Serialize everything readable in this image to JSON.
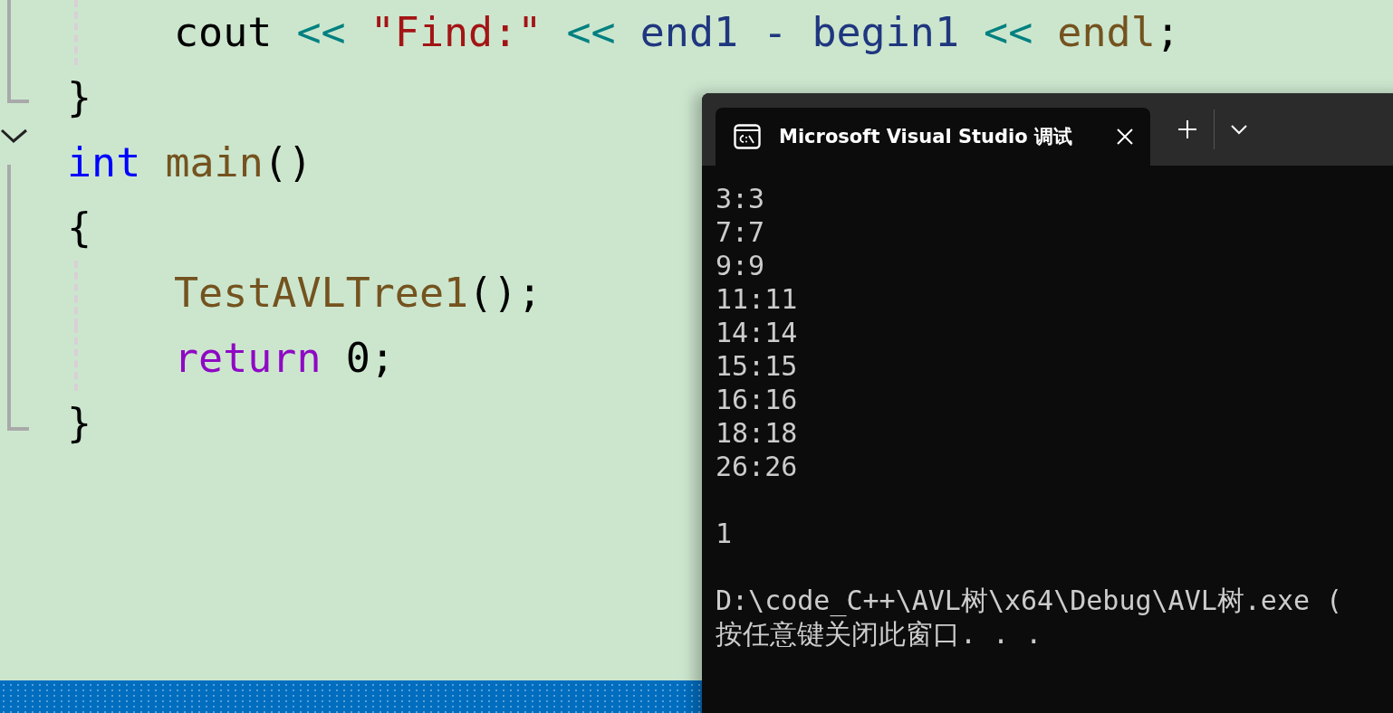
{
  "editor": {
    "lines": [
      {
        "indented": true,
        "tokens": [
          {
            "kind": "plain",
            "text": "cout "
          },
          {
            "kind": "op",
            "text": "<< "
          },
          {
            "kind": "string",
            "text": "\"Find:\" "
          },
          {
            "kind": "op",
            "text": "<< "
          },
          {
            "kind": "var",
            "text": "end1 - begin1 "
          },
          {
            "kind": "op",
            "text": "<< "
          },
          {
            "kind": "func",
            "text": "endl"
          },
          {
            "kind": "plain",
            "text": ";"
          }
        ]
      },
      {
        "indented": false,
        "tokens": [
          {
            "kind": "plain",
            "text": "}"
          }
        ]
      },
      {
        "indented": false,
        "tokens": [
          {
            "kind": "keyword",
            "text": "int "
          },
          {
            "kind": "func",
            "text": "main"
          },
          {
            "kind": "plain",
            "text": "()"
          }
        ]
      },
      {
        "indented": false,
        "tokens": [
          {
            "kind": "plain",
            "text": "{"
          }
        ]
      },
      {
        "indented": true,
        "tokens": [
          {
            "kind": "func",
            "text": "TestAVLTree1"
          },
          {
            "kind": "plain",
            "text": "();"
          }
        ]
      },
      {
        "indented": true,
        "tokens": [
          {
            "kind": "control",
            "text": "return "
          },
          {
            "kind": "plain",
            "text": "0;"
          }
        ]
      },
      {
        "indented": false,
        "tokens": [
          {
            "kind": "plain",
            "text": "}"
          }
        ]
      }
    ]
  },
  "terminal": {
    "tab": {
      "title": "Microsoft Visual Studio 调试",
      "selected": true
    },
    "output": [
      [
        "3:3",
        "7:7",
        "9:9",
        "11:11",
        "14:14",
        "15:15",
        "16:16",
        "18:18",
        "26:26"
      ],
      [
        "1"
      ],
      [
        "D:\\code_C++\\AVL树\\x64\\Debug\\AVL树.exe (",
        "按任意键关闭此窗口. . ."
      ]
    ]
  }
}
